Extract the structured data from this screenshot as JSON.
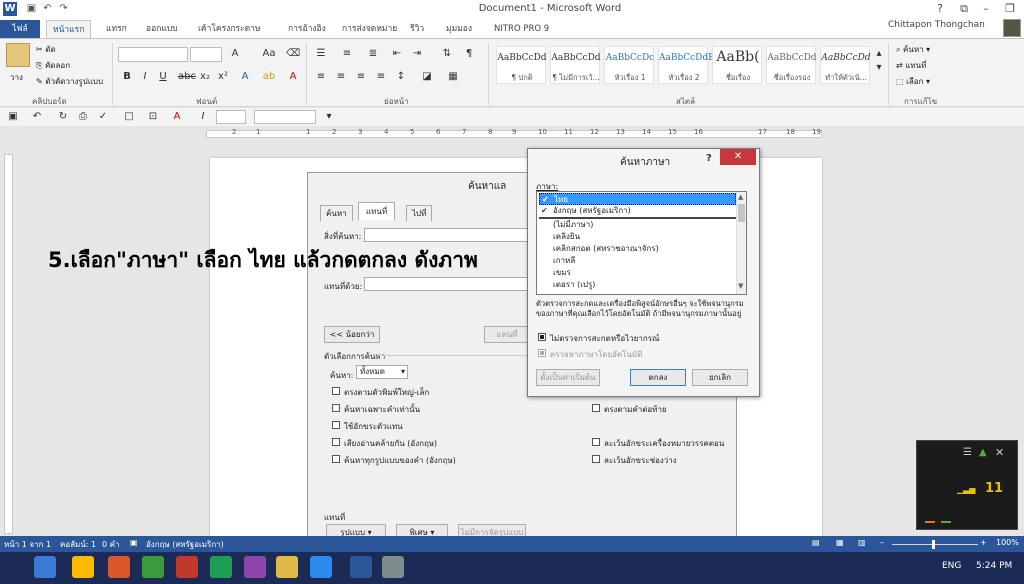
{
  "window": {
    "title": "Document1 - Microsoft Word",
    "user": "Chittapon Thongchan",
    "logo": "W"
  },
  "tabs": [
    "ไฟล์",
    "หน้าแรก",
    "แทรก",
    "ออกแบบ",
    "เค้าโครงกระดาษ",
    "การอ้างอิง",
    "การส่งจดหมาย",
    "รีวิว",
    "มุมมอง",
    "NITRO PRO 9"
  ],
  "ribbon": {
    "paste_label": "วาง",
    "clipboard": {
      "cut": "ตัด",
      "copy": "คัดลอก",
      "format_painter": "ตัวคัดวางรูปแบบ",
      "group": "คลิปบอร์ด"
    },
    "font_group": "ฟอนต์",
    "paragraph_group": "ย่อหน้า",
    "styles_group": "สไตล์",
    "editing_group": "การแก้ไข",
    "styles": [
      {
        "sample": "AaBbCcDd",
        "name": "¶ ปกติ"
      },
      {
        "sample": "AaBbCcDd",
        "name": "¶ ไม่มีการเว้..."
      },
      {
        "sample": "AaBbCcDc",
        "name": "หัวเรื่อง 1"
      },
      {
        "sample": "AaBbCcDdE",
        "name": "หัวเรื่อง 2"
      },
      {
        "sample": "AaBb(",
        "name": "ชื่อเรื่อง"
      },
      {
        "sample": "AaBbCcDd",
        "name": "ชื่อเรื่องรอง"
      },
      {
        "sample": "AaBbCcDd",
        "name": "ทำให้ตัวเน้..."
      }
    ],
    "editing": {
      "find": "ค้นหา",
      "replace": "แทนที่",
      "select": "เลือก"
    }
  },
  "ruler_numbers": [
    "2",
    "1",
    "1",
    "2",
    "3",
    "4",
    "5",
    "6",
    "7",
    "8",
    "9",
    "10",
    "11",
    "12",
    "13",
    "14",
    "15",
    "16",
    "17",
    "18",
    "19"
  ],
  "caption": "5.เลือก\"ภาษา\" เลือก ไทย แล้วกดตกลง ดังภาพ",
  "find_dialog": {
    "title": "ค้นหาแล",
    "tabs": [
      "ค้นหา",
      "แทนที่",
      "ไปที่"
    ],
    "find_label": "สิ่งที่ค้นหา:",
    "replace_label": "แทนที่ด้วย:",
    "less_button": "<< น้อยกว่า",
    "replace_button": "แทนที่",
    "options_header": "ตัวเลือกการค้นหา",
    "search_label": "ค้นหา:",
    "search_value": "ทั้งหมด",
    "options_left": [
      "ตรงตามตัวพิมพ์ใหญ่-เล็ก",
      "ค้นหาเฉพาะคำเท่านั้น",
      "ใช้อักขระตัวแทน",
      "เสียงอ่านคล้ายกัน (อังกฤษ)",
      "ค้นหาทุกรูปแบบของคำ (อังกฤษ)"
    ],
    "options_right": [
      "ตรงตามคำต่อท้าย",
      "ละเว้นอักขระเครื่องหมายวรรคตอน",
      "ละเว้นอักขระช่องว่าง"
    ],
    "replace_header": "แทนที่",
    "format_button": "รูปแบบ ▾",
    "special_button": "พิเศษ ▾",
    "no_format_button": "ไม่มีการจัดรูปแบบ"
  },
  "language_dialog": {
    "title": "ค้นหาภาษา",
    "help": "?",
    "close": "✕",
    "list_label": "ภาษา:",
    "languages": [
      "ไทย",
      "อังกฤษ (สหรัฐอเมริกา)",
      "(ไม่มีภาษา)",
      "เคลิงยิน",
      "เคลิกสกอต (สหราชอาณาจักร)",
      "เกาหลี",
      "เขมร",
      "เตอรา (เปรู)"
    ],
    "description": "ตัวตรวจการสะกดและเครื่องมือพิสูจน์อักษรอื่นๆ จะใช้พจนานุกรมของภาษาที่คุณเลือกไว้โดยอัตโนมัติ ถ้ามีพจนานุกรมภาษานั้นอยู่",
    "no_proof": "ไม่ตรวจการสะกดหรือไวยากรณ์",
    "detect_auto": "ตรวจหาภาษาโดยอัตโนมัติ",
    "default_button": "ตั้งเป็นค่าเริ่มต้น",
    "ok_button": "ตกลง",
    "cancel_button": "ยกเลิก"
  },
  "status": {
    "page": "หน้า 1 จาก 1",
    "words": "คอลัมน์: 1",
    "count": "0 คำ",
    "lang": "อังกฤษ (สหรัฐอเมริกา)",
    "zoom": "100%"
  },
  "taskbar": {
    "lang": "ENG",
    "time": "5:24 PM"
  },
  "gadget": {
    "value": "11"
  },
  "colors": {
    "accent": "#2b579a",
    "selection": "#3399ff",
    "close_red": "#c7373b"
  }
}
